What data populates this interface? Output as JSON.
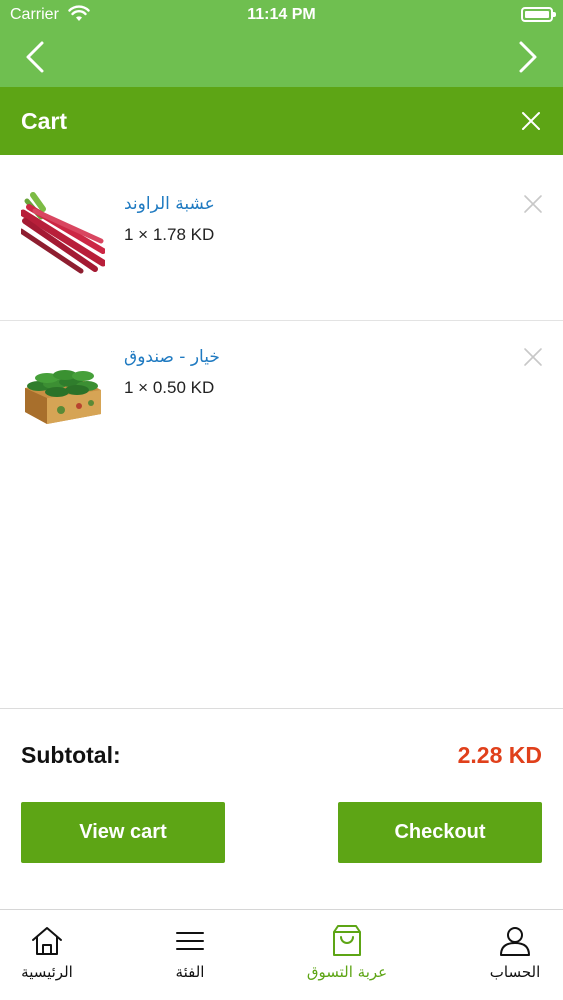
{
  "status_bar": {
    "carrier": "Carrier",
    "time": "11:14 PM"
  },
  "cart": {
    "title": "Cart",
    "items": [
      {
        "name": "عشبة الراوند",
        "qty_price": "1 × 1.78 KD",
        "image": "rhubarb"
      },
      {
        "name": "خيار - صندوق",
        "qty_price": "1 × 0.50 KD",
        "image": "cucumber-box"
      }
    ],
    "subtotal_label": "Subtotal:",
    "subtotal_value": "2.28 KD",
    "view_cart_label": "View cart",
    "checkout_label": "Checkout"
  },
  "tabs": [
    {
      "label": "الرئيسية",
      "icon": "home-icon"
    },
    {
      "label": "الفئة",
      "icon": "menu-icon"
    },
    {
      "label": "عربة التسوق",
      "icon": "shopping-bag-icon",
      "active": true
    },
    {
      "label": "الحساب",
      "icon": "user-icon"
    }
  ],
  "colors": {
    "nav_green": "#6fbf50",
    "header_green": "#5da515",
    "link_blue": "#1f7ac1",
    "price_red": "#e0401b"
  }
}
